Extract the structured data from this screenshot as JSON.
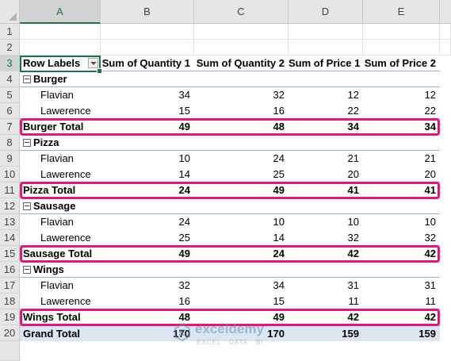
{
  "columns": [
    "A",
    "B",
    "C",
    "D",
    "E"
  ],
  "row_numbers": [
    "1",
    "2",
    "3",
    "4",
    "5",
    "6",
    "7",
    "8",
    "9",
    "10",
    "11",
    "12",
    "13",
    "14",
    "15",
    "16",
    "17",
    "18",
    "19",
    "20"
  ],
  "pivot": {
    "header": [
      "Row Labels",
      "Sum of Quantity 1",
      "Sum of Quantity 2",
      "Sum of Price 1",
      "Sum of Price 2"
    ],
    "groups": [
      {
        "name": "Burger",
        "items": [
          {
            "label": "Flavian",
            "values": [
              "34",
              "32",
              "12",
              "12"
            ]
          },
          {
            "label": "Lawerence",
            "values": [
              "15",
              "16",
              "22",
              "22"
            ]
          }
        ],
        "total": {
          "label": "Burger Total",
          "values": [
            "49",
            "48",
            "34",
            "34"
          ]
        }
      },
      {
        "name": "Pizza",
        "items": [
          {
            "label": "Flavian",
            "values": [
              "10",
              "24",
              "21",
              "21"
            ]
          },
          {
            "label": "Lawerence",
            "values": [
              "14",
              "25",
              "20",
              "20"
            ]
          }
        ],
        "total": {
          "label": "Pizza Total",
          "values": [
            "24",
            "49",
            "41",
            "41"
          ]
        }
      },
      {
        "name": "Sausage",
        "items": [
          {
            "label": "Flavian",
            "values": [
              "24",
              "10",
              "10",
              "10"
            ]
          },
          {
            "label": "Lawerence",
            "values": [
              "25",
              "14",
              "32",
              "32"
            ]
          }
        ],
        "total": {
          "label": "Sausage Total",
          "values": [
            "49",
            "24",
            "42",
            "42"
          ]
        }
      },
      {
        "name": "Wings",
        "items": [
          {
            "label": "Flavian",
            "values": [
              "32",
              "34",
              "31",
              "31"
            ]
          },
          {
            "label": "Lawerence",
            "values": [
              "16",
              "15",
              "11",
              "11"
            ]
          }
        ],
        "total": {
          "label": "Wings Total",
          "values": [
            "48",
            "49",
            "42",
            "42"
          ]
        }
      }
    ],
    "grand_total": {
      "label": "Grand Total",
      "values": [
        "170",
        "170",
        "159",
        "159"
      ]
    }
  },
  "watermark": {
    "name": "exceldemy",
    "tagline": "EXCEL · DATA · BI"
  },
  "colors": {
    "highlight": "#e0187d",
    "selection": "#217346",
    "header_line": "#95b3d7",
    "grand_fill": "#dce6f1"
  }
}
